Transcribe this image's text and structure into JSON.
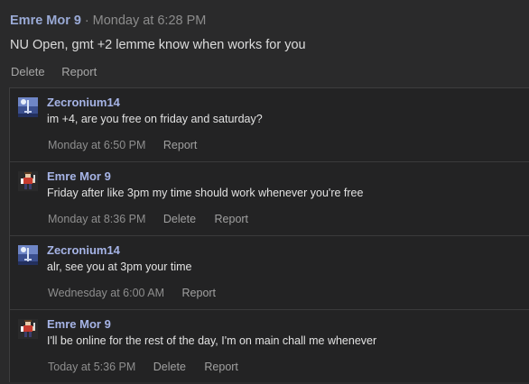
{
  "post": {
    "author": "Emre Mor 9",
    "separator": "·",
    "time": "Monday at 6:28 PM",
    "text": "NU Open, gmt +2 lemme know when works for you",
    "delete_label": "Delete",
    "report_label": "Report"
  },
  "replies": [
    {
      "author": "Zecronium14",
      "avatar": "moon-sword-avatar",
      "text": "im +4, are you free on friday and saturday?",
      "time": "Monday at 6:50 PM",
      "report_label": "Report"
    },
    {
      "author": "Emre Mor 9",
      "avatar": "character-sprite-avatar",
      "text": "Friday after like 3pm my time should work whenever you're free",
      "time": "Monday at 8:36 PM",
      "delete_label": "Delete",
      "report_label": "Report"
    },
    {
      "author": "Zecronium14",
      "avatar": "moon-sword-avatar",
      "text": "alr, see you at 3pm your time",
      "time": "Wednesday at 6:00 AM",
      "report_label": "Report"
    },
    {
      "author": "Emre Mor 9",
      "avatar": "character-sprite-avatar",
      "text": "I'll be online for the rest of the day, I'm on main chall me whenever",
      "time": "Today at 5:36 PM",
      "delete_label": "Delete",
      "report_label": "Report"
    }
  ],
  "colors": {
    "background": "#2a2a2b",
    "author": "#9aaad6",
    "meta": "#8c8c8c"
  }
}
